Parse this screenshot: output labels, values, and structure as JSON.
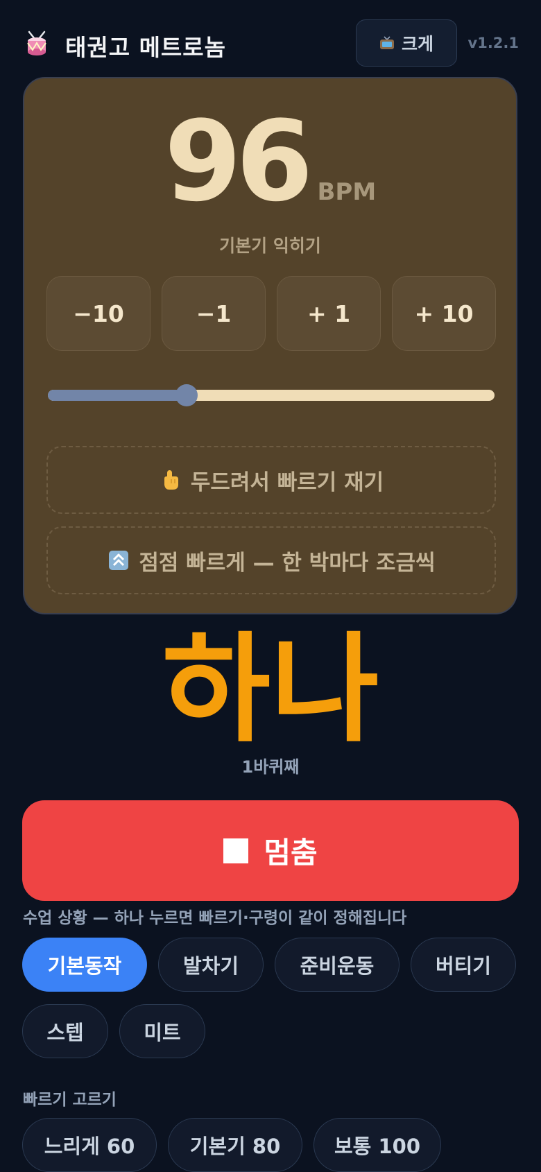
{
  "header": {
    "app_icon": "drum-icon",
    "title": "태권고 메트로놈",
    "big_button_icon": "tv-icon",
    "big_button_label": "크게",
    "version": "v1.2.1"
  },
  "tempo": {
    "bpm": "96",
    "unit": "BPM",
    "mode_label": "기본기 익히기",
    "steps": [
      "−10",
      "−1",
      "+ 1",
      "+ 10"
    ],
    "slider_fraction": 0.31,
    "tap_icon": "pointing-hand-icon",
    "tap_label": "두드려서 빠르기 재기",
    "ramp_icon": "up-arrows-icon",
    "ramp_label": "점점 빠르게 — 한 박마다 조금씩"
  },
  "count": {
    "word": "하나",
    "round": "1바퀴째"
  },
  "stop_button": {
    "icon": "stop-square-icon",
    "label": "멈춤"
  },
  "class_section": {
    "label": "수업 상황 — 하나 누르면 빠르기·구령이 같이 정해집니다",
    "chips": [
      "기본동작",
      "발차기",
      "준비운동",
      "버티기",
      "스텝",
      "미트"
    ],
    "selected": "기본동작"
  },
  "speed_section": {
    "label": "빠르기 고르기",
    "chips": [
      "느리게 60",
      "기본기 80",
      "보통 100"
    ]
  },
  "colors": {
    "background": "#0b1220",
    "panel": "#54432a",
    "accent_count": "#f59e0b",
    "stop": "#ef4444",
    "chip_active": "#3b82f6"
  }
}
